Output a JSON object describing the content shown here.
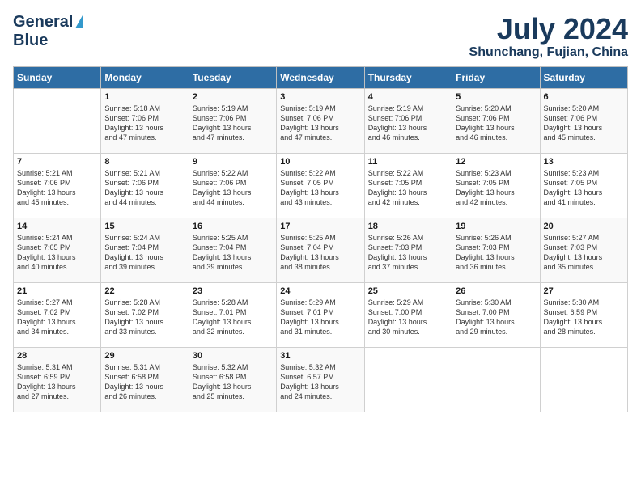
{
  "header": {
    "logo_general": "General",
    "logo_blue": "Blue",
    "month_year": "July 2024",
    "location": "Shunchang, Fujian, China"
  },
  "weekdays": [
    "Sunday",
    "Monday",
    "Tuesday",
    "Wednesday",
    "Thursday",
    "Friday",
    "Saturday"
  ],
  "weeks": [
    [
      {
        "num": "",
        "info": ""
      },
      {
        "num": "1",
        "info": "Sunrise: 5:18 AM\nSunset: 7:06 PM\nDaylight: 13 hours\nand 47 minutes."
      },
      {
        "num": "2",
        "info": "Sunrise: 5:19 AM\nSunset: 7:06 PM\nDaylight: 13 hours\nand 47 minutes."
      },
      {
        "num": "3",
        "info": "Sunrise: 5:19 AM\nSunset: 7:06 PM\nDaylight: 13 hours\nand 47 minutes."
      },
      {
        "num": "4",
        "info": "Sunrise: 5:19 AM\nSunset: 7:06 PM\nDaylight: 13 hours\nand 46 minutes."
      },
      {
        "num": "5",
        "info": "Sunrise: 5:20 AM\nSunset: 7:06 PM\nDaylight: 13 hours\nand 46 minutes."
      },
      {
        "num": "6",
        "info": "Sunrise: 5:20 AM\nSunset: 7:06 PM\nDaylight: 13 hours\nand 45 minutes."
      }
    ],
    [
      {
        "num": "7",
        "info": "Sunrise: 5:21 AM\nSunset: 7:06 PM\nDaylight: 13 hours\nand 45 minutes."
      },
      {
        "num": "8",
        "info": "Sunrise: 5:21 AM\nSunset: 7:06 PM\nDaylight: 13 hours\nand 44 minutes."
      },
      {
        "num": "9",
        "info": "Sunrise: 5:22 AM\nSunset: 7:06 PM\nDaylight: 13 hours\nand 44 minutes."
      },
      {
        "num": "10",
        "info": "Sunrise: 5:22 AM\nSunset: 7:05 PM\nDaylight: 13 hours\nand 43 minutes."
      },
      {
        "num": "11",
        "info": "Sunrise: 5:22 AM\nSunset: 7:05 PM\nDaylight: 13 hours\nand 42 minutes."
      },
      {
        "num": "12",
        "info": "Sunrise: 5:23 AM\nSunset: 7:05 PM\nDaylight: 13 hours\nand 42 minutes."
      },
      {
        "num": "13",
        "info": "Sunrise: 5:23 AM\nSunset: 7:05 PM\nDaylight: 13 hours\nand 41 minutes."
      }
    ],
    [
      {
        "num": "14",
        "info": "Sunrise: 5:24 AM\nSunset: 7:05 PM\nDaylight: 13 hours\nand 40 minutes."
      },
      {
        "num": "15",
        "info": "Sunrise: 5:24 AM\nSunset: 7:04 PM\nDaylight: 13 hours\nand 39 minutes."
      },
      {
        "num": "16",
        "info": "Sunrise: 5:25 AM\nSunset: 7:04 PM\nDaylight: 13 hours\nand 39 minutes."
      },
      {
        "num": "17",
        "info": "Sunrise: 5:25 AM\nSunset: 7:04 PM\nDaylight: 13 hours\nand 38 minutes."
      },
      {
        "num": "18",
        "info": "Sunrise: 5:26 AM\nSunset: 7:03 PM\nDaylight: 13 hours\nand 37 minutes."
      },
      {
        "num": "19",
        "info": "Sunrise: 5:26 AM\nSunset: 7:03 PM\nDaylight: 13 hours\nand 36 minutes."
      },
      {
        "num": "20",
        "info": "Sunrise: 5:27 AM\nSunset: 7:03 PM\nDaylight: 13 hours\nand 35 minutes."
      }
    ],
    [
      {
        "num": "21",
        "info": "Sunrise: 5:27 AM\nSunset: 7:02 PM\nDaylight: 13 hours\nand 34 minutes."
      },
      {
        "num": "22",
        "info": "Sunrise: 5:28 AM\nSunset: 7:02 PM\nDaylight: 13 hours\nand 33 minutes."
      },
      {
        "num": "23",
        "info": "Sunrise: 5:28 AM\nSunset: 7:01 PM\nDaylight: 13 hours\nand 32 minutes."
      },
      {
        "num": "24",
        "info": "Sunrise: 5:29 AM\nSunset: 7:01 PM\nDaylight: 13 hours\nand 31 minutes."
      },
      {
        "num": "25",
        "info": "Sunrise: 5:29 AM\nSunset: 7:00 PM\nDaylight: 13 hours\nand 30 minutes."
      },
      {
        "num": "26",
        "info": "Sunrise: 5:30 AM\nSunset: 7:00 PM\nDaylight: 13 hours\nand 29 minutes."
      },
      {
        "num": "27",
        "info": "Sunrise: 5:30 AM\nSunset: 6:59 PM\nDaylight: 13 hours\nand 28 minutes."
      }
    ],
    [
      {
        "num": "28",
        "info": "Sunrise: 5:31 AM\nSunset: 6:59 PM\nDaylight: 13 hours\nand 27 minutes."
      },
      {
        "num": "29",
        "info": "Sunrise: 5:31 AM\nSunset: 6:58 PM\nDaylight: 13 hours\nand 26 minutes."
      },
      {
        "num": "30",
        "info": "Sunrise: 5:32 AM\nSunset: 6:58 PM\nDaylight: 13 hours\nand 25 minutes."
      },
      {
        "num": "31",
        "info": "Sunrise: 5:32 AM\nSunset: 6:57 PM\nDaylight: 13 hours\nand 24 minutes."
      },
      {
        "num": "",
        "info": ""
      },
      {
        "num": "",
        "info": ""
      },
      {
        "num": "",
        "info": ""
      }
    ]
  ]
}
